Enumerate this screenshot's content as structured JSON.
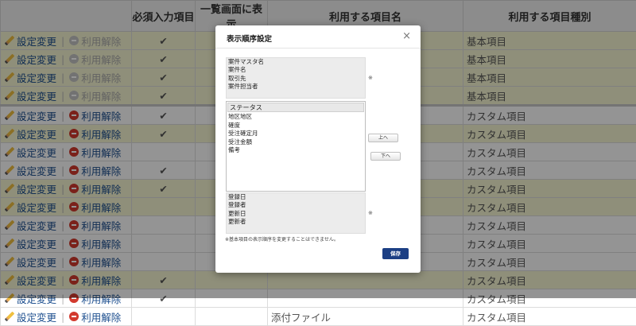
{
  "table": {
    "headers": [
      "",
      "必須入力項目",
      "一覧画面に表示",
      "利用する項目名",
      "利用する項目種別"
    ],
    "edit_label": "設定変更",
    "disable_label": "利用解除",
    "check_glyph": "✔",
    "rows": [
      {
        "bg": "yellow",
        "disabled": true,
        "required": true,
        "type": "基本項目",
        "name": ""
      },
      {
        "bg": "yellow",
        "disabled": true,
        "required": true,
        "type": "基本項目",
        "name": ""
      },
      {
        "bg": "yellow",
        "disabled": true,
        "required": true,
        "type": "基本項目",
        "name": ""
      },
      {
        "bg": "yellow",
        "disabled": true,
        "required": true,
        "type": "基本項目",
        "name": ""
      },
      {
        "bg": "white",
        "disabled": false,
        "required": true,
        "type": "カスタム項目",
        "name": "",
        "sep": true
      },
      {
        "bg": "yellow",
        "disabled": false,
        "required": true,
        "type": "カスタム項目",
        "name": ""
      },
      {
        "bg": "white",
        "disabled": false,
        "required": false,
        "type": "カスタム項目",
        "name": ""
      },
      {
        "bg": "white",
        "disabled": false,
        "required": true,
        "type": "カスタム項目",
        "name": ""
      },
      {
        "bg": "yellow",
        "disabled": false,
        "required": true,
        "type": "カスタム項目",
        "name": ""
      },
      {
        "bg": "yellow",
        "disabled": false,
        "required": false,
        "type": "カスタム項目",
        "name": ""
      },
      {
        "bg": "white",
        "disabled": false,
        "required": false,
        "type": "カスタム項目",
        "name": ""
      },
      {
        "bg": "white",
        "disabled": false,
        "required": false,
        "type": "カスタム項目",
        "name": ""
      },
      {
        "bg": "white",
        "disabled": false,
        "required": false,
        "type": "カスタム項目",
        "name": ""
      },
      {
        "bg": "yellow",
        "disabled": false,
        "required": true,
        "type": "カスタム項目",
        "name": ""
      },
      {
        "bg": "white",
        "disabled": false,
        "required": true,
        "type": "カスタム項目",
        "name": ""
      },
      {
        "bg": "white",
        "disabled": false,
        "required": false,
        "type": "カスタム項目",
        "name": "添付ファイル"
      }
    ]
  },
  "dialog": {
    "title": "表示順序設定",
    "close_glyph": "×",
    "top_items": [
      "案件マスタ名",
      "案件名",
      "取引先",
      "案件担当者"
    ],
    "list_items": [
      "ステータス",
      "地区地区",
      "確度",
      "受注確定月",
      "受注金額",
      "備考"
    ],
    "bottom_items": [
      "登録日",
      "登録者",
      "更新日",
      "更新者"
    ],
    "fixed_mark": "※",
    "up_label": "上へ",
    "down_label": "下へ",
    "note": "※基本項目の表示順序を変更することはできません。",
    "save_label": "保存"
  }
}
